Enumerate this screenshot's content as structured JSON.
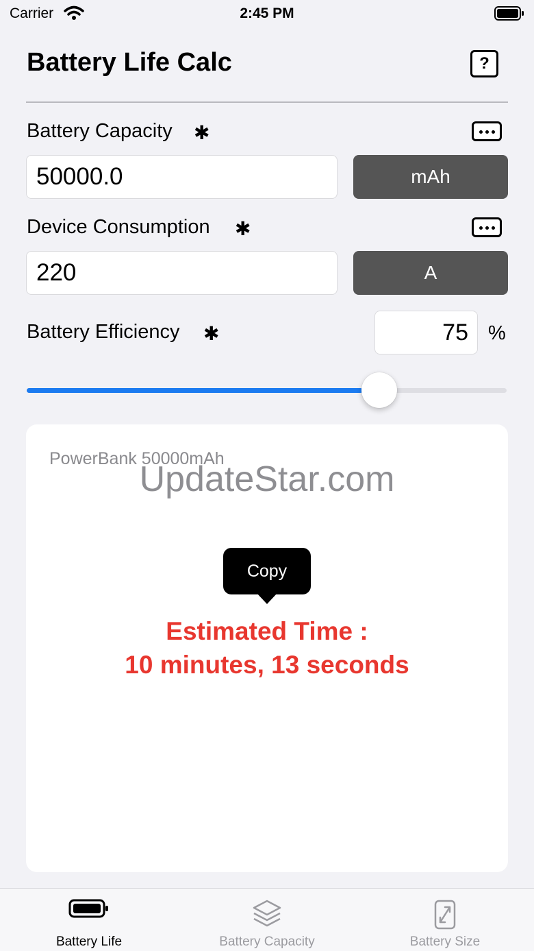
{
  "status_bar": {
    "carrier": "Carrier",
    "time": "2:45 PM"
  },
  "header": {
    "title": "Battery Life Calc",
    "help_label": "?"
  },
  "capacity": {
    "label": "Battery Capacity",
    "required_mark": "✱",
    "value": "50000.0",
    "unit": "mAh"
  },
  "consumption": {
    "label": "Device Consumption",
    "required_mark": "✱",
    "value": "220",
    "unit": "A"
  },
  "efficiency": {
    "label": "Battery Efficiency",
    "required_mark": "✱",
    "value": "75",
    "percent_sign": "%",
    "slider_fraction": 0.7
  },
  "result": {
    "preset_name": "PowerBank 50000mAh",
    "watermark": "UpdateStar.com",
    "copy_label": "Copy",
    "estimate_line1": "Estimated Time :",
    "estimate_line2": "10 minutes, 13 seconds"
  },
  "tabs": [
    {
      "label": "Battery Life",
      "icon": "battery-icon",
      "active": true
    },
    {
      "label": "Battery Capacity",
      "icon": "layers-icon",
      "active": false
    },
    {
      "label": "Battery Size",
      "icon": "resize-icon",
      "active": false
    }
  ],
  "colors": {
    "accent": "#1c7bf0",
    "result_text": "#e8372f",
    "unit_button": "#555555",
    "background": "#f2f2f6"
  }
}
